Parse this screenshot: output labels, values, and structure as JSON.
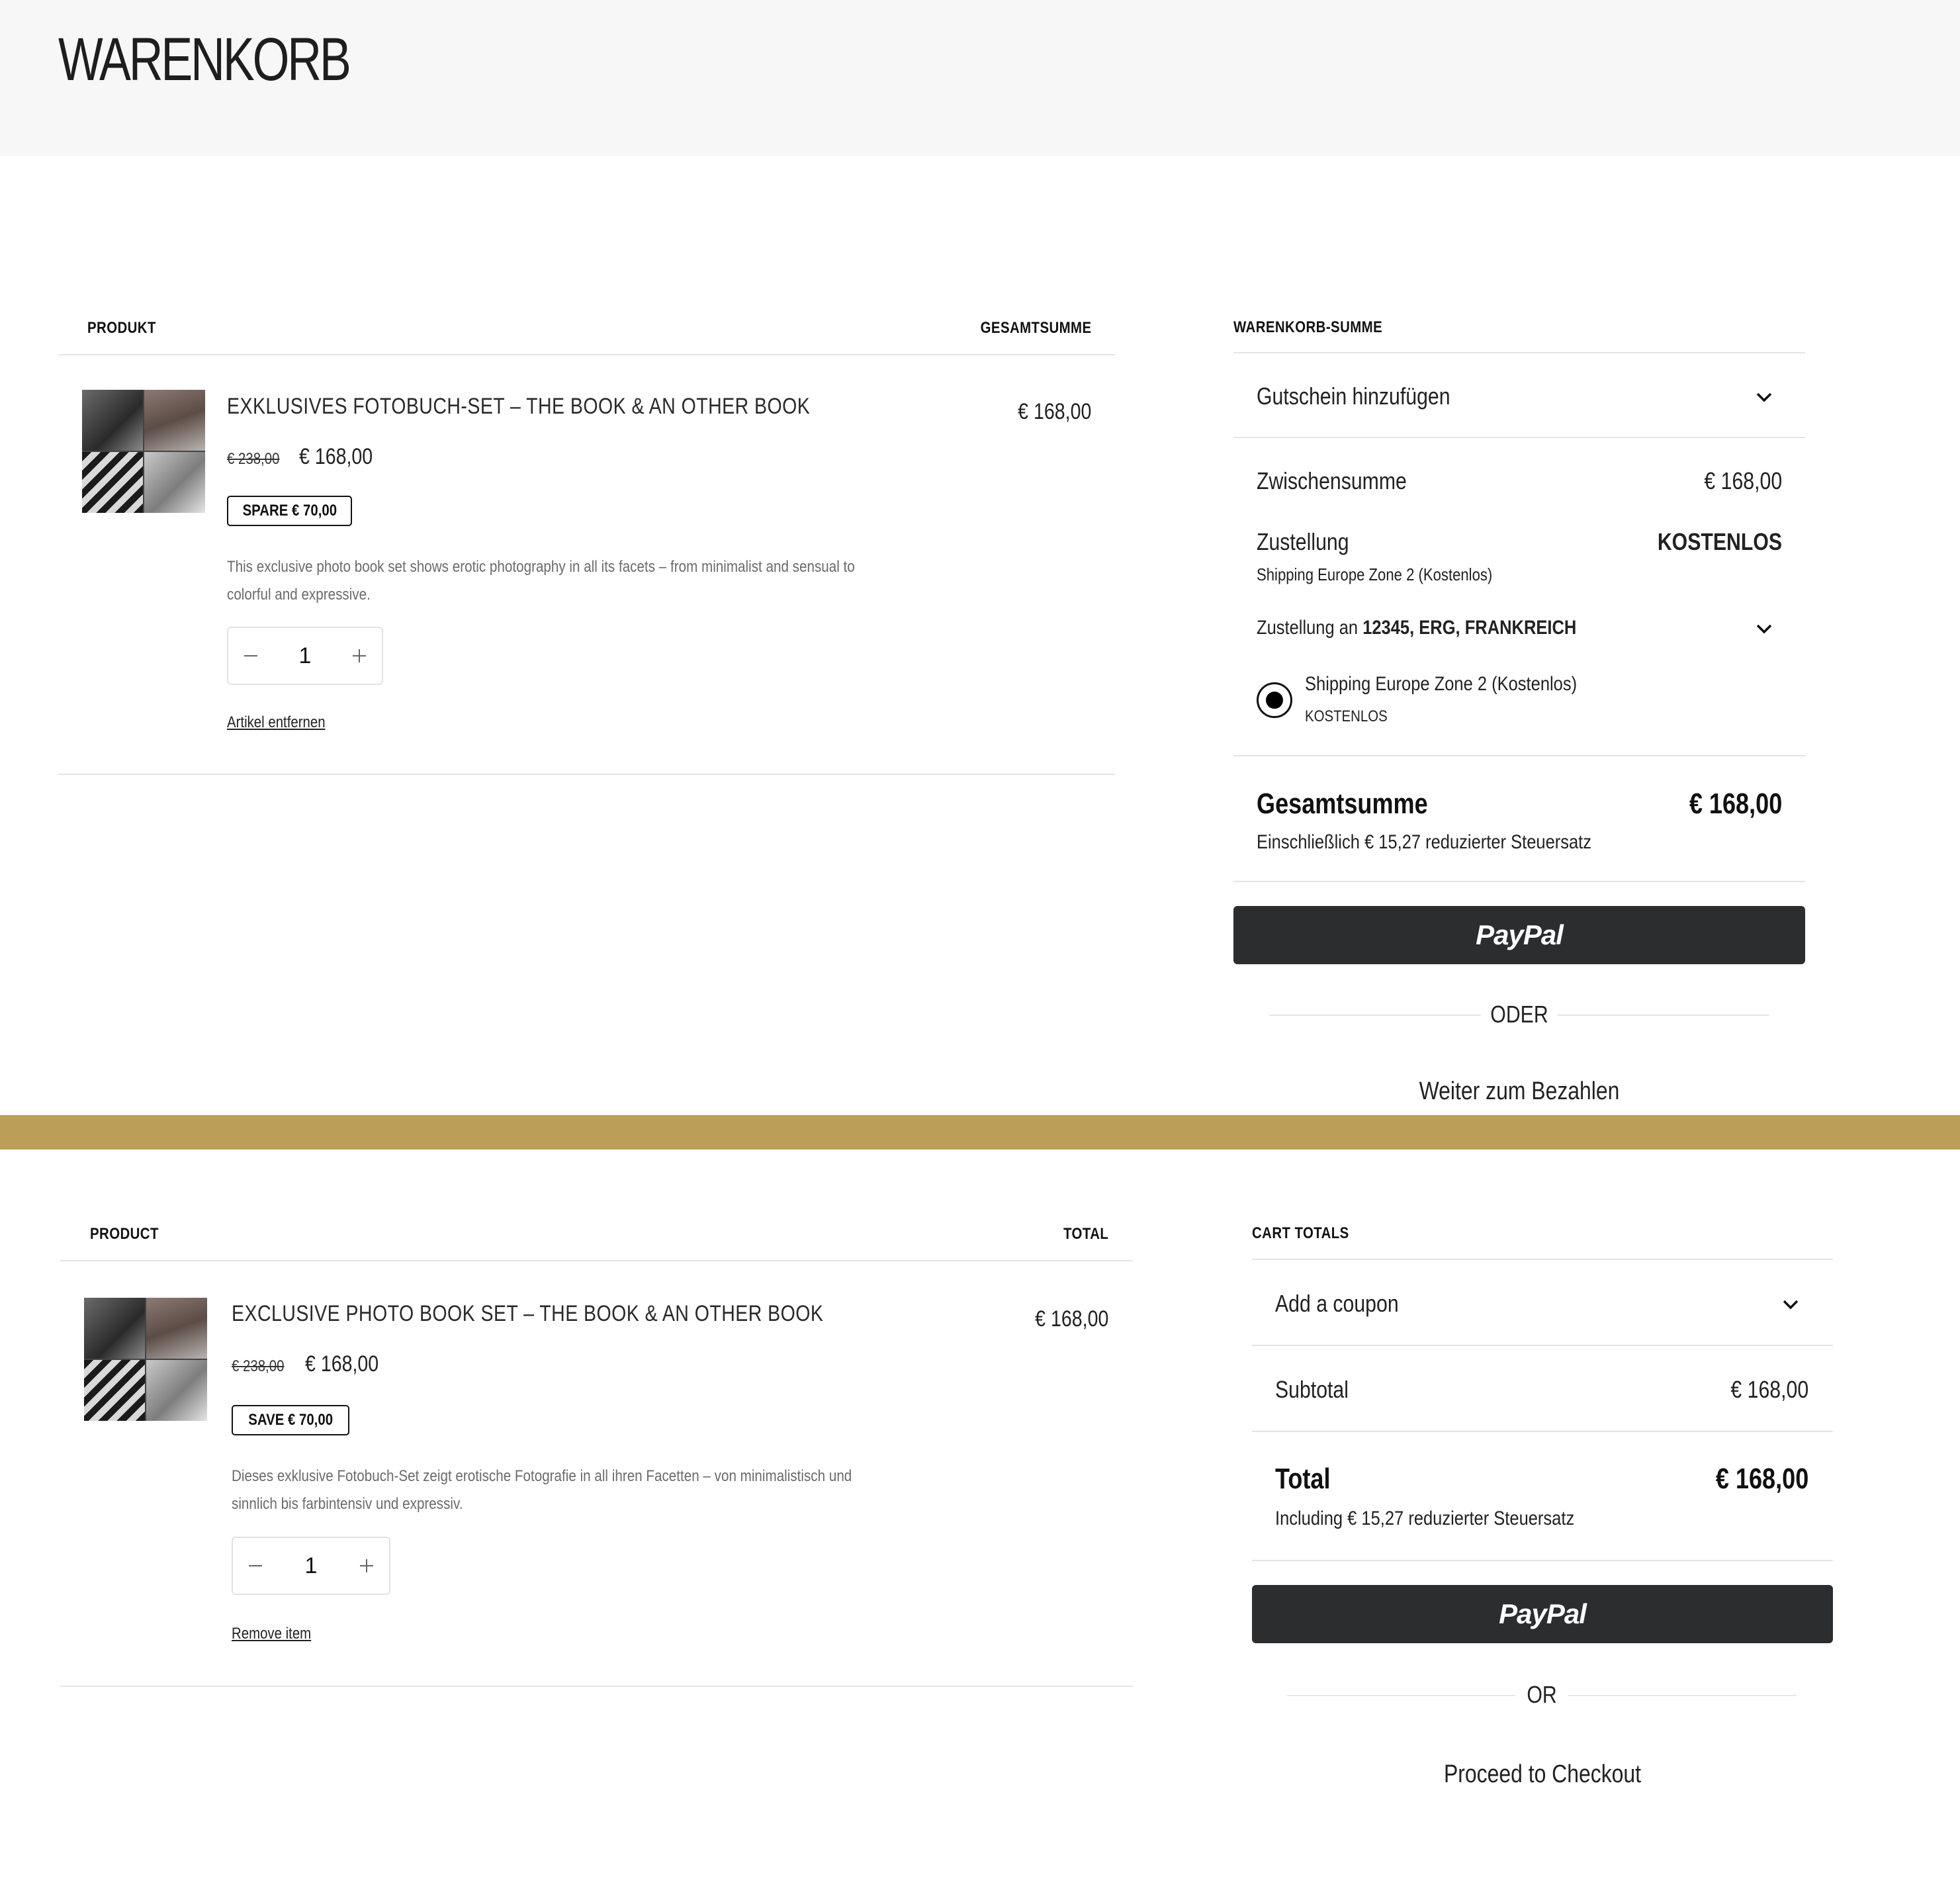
{
  "page_title": "WARENKORB",
  "de": {
    "table": {
      "col_product": "PRODUKT",
      "col_total": "GESAMTSUMME",
      "item": {
        "name": "EXKLUSIVES FOTOBUCH-SET – THE BOOK & AN OTHER BOOK",
        "price_old": "€ 238,00",
        "price_new": "€ 168,00",
        "badge": "SPARE € 70,00",
        "description_line1": "This exclusive photo book set shows erotic photography in all its facets – from minimalist and sensual to",
        "description_line2": "colorful and expressive.",
        "quantity": "1",
        "remove": "Artikel entfernen",
        "line_total": "€ 168,00"
      }
    },
    "summary": {
      "heading": "WARENKORB-SUMME",
      "coupon": "Gutschein hinzufügen",
      "subtotal_label": "Zwischensumme",
      "subtotal_value": "€ 168,00",
      "shipping_label": "Zustellung",
      "shipping_value": "KOSTENLOS",
      "shipping_method": "Shipping Europe Zone 2 (Kostenlos)",
      "deliver_to_prefix": "Zustellung an",
      "deliver_to_address": "12345, ERG, FRANKREICH",
      "option_label": "Shipping Europe Zone 2 (Kostenlos)",
      "option_price": "KOSTENLOS",
      "total_label": "Gesamtsumme",
      "total_value": "€ 168,00",
      "tax_note": "Einschließlich € 15,27 reduzierter Steuersatz",
      "paypal": "PayPal",
      "or": "ODER",
      "proceed": "Weiter zum Bezahlen"
    }
  },
  "en": {
    "table": {
      "col_product": "PRODUCT",
      "col_total": "TOTAL",
      "item": {
        "name": "EXCLUSIVE PHOTO BOOK SET – THE BOOK & AN OTHER BOOK",
        "price_old": "€ 238,00",
        "price_new": "€ 168,00",
        "badge": "SAVE € 70,00",
        "description_line1": "Dieses exklusive Fotobuch-Set zeigt erotische Fotografie in all ihren Facetten – von minimalistisch und",
        "description_line2": "sinnlich bis farbintensiv und expressiv.",
        "quantity": "1",
        "remove": "Remove item",
        "line_total": "€ 168,00"
      }
    },
    "summary": {
      "heading": "CART TOTALS",
      "coupon": "Add a coupon",
      "subtotal_label": "Subtotal",
      "subtotal_value": "€ 168,00",
      "total_label": "Total",
      "total_value": "€ 168,00",
      "tax_note": "Including € 15,27 reduzierter Steuersatz",
      "paypal": "PayPal",
      "or": "OR",
      "proceed": "Proceed to Checkout"
    }
  },
  "icons": {
    "chevron": "chevron-down-icon",
    "minus": "minus-icon",
    "plus": "plus-icon"
  },
  "colors": {
    "divider_band": "#bb9e57",
    "paypal_button": "#2c2d2f",
    "header_band": "#f7f7f7"
  }
}
